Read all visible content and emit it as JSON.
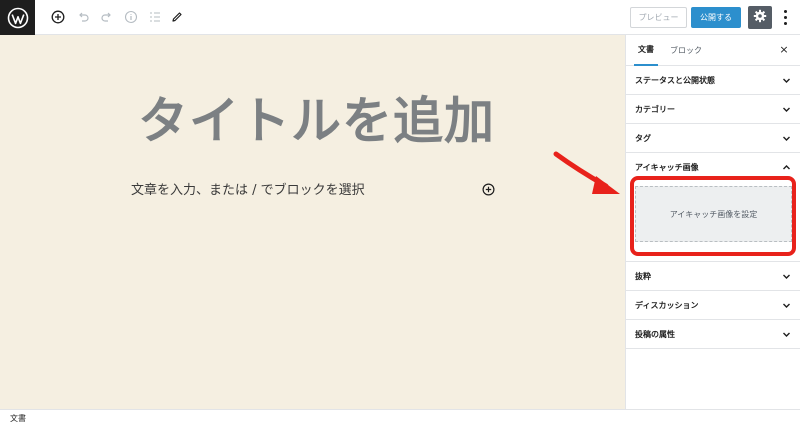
{
  "toolbar": {
    "preview_label": "プレビュー",
    "publish_label": "公開する",
    "icons": [
      "wordpress-logo",
      "add-block-icon",
      "undo-icon",
      "redo-icon",
      "info-icon",
      "list-view-icon",
      "edit-icon",
      "gear-icon",
      "more-options-icon"
    ]
  },
  "editor": {
    "title_placeholder": "タイトルを追加",
    "block_placeholder": "文章を入力、または / でブロックを選択"
  },
  "sidebar": {
    "tabs": [
      {
        "label": "文書",
        "active": true
      },
      {
        "label": "ブロック",
        "active": false
      }
    ],
    "panels": [
      {
        "label": "ステータスと公開状態",
        "expanded": false
      },
      {
        "label": "カテゴリー",
        "expanded": false
      },
      {
        "label": "タグ",
        "expanded": false
      },
      {
        "label": "アイキャッチ画像",
        "expanded": true
      },
      {
        "label": "抜粋",
        "expanded": false
      },
      {
        "label": "ディスカッション",
        "expanded": false
      },
      {
        "label": "投稿の属性",
        "expanded": false
      }
    ],
    "featured_image_button": "アイキャッチ画像を設定"
  },
  "statusbar": {
    "breadcrumb": "文書"
  },
  "colors": {
    "accent": "#2c8fcd",
    "canvas_bg": "#f5efe1",
    "annotation": "#e8221b",
    "toolbar_dark": "#1e1e1e",
    "settings_bg": "#555d66"
  }
}
